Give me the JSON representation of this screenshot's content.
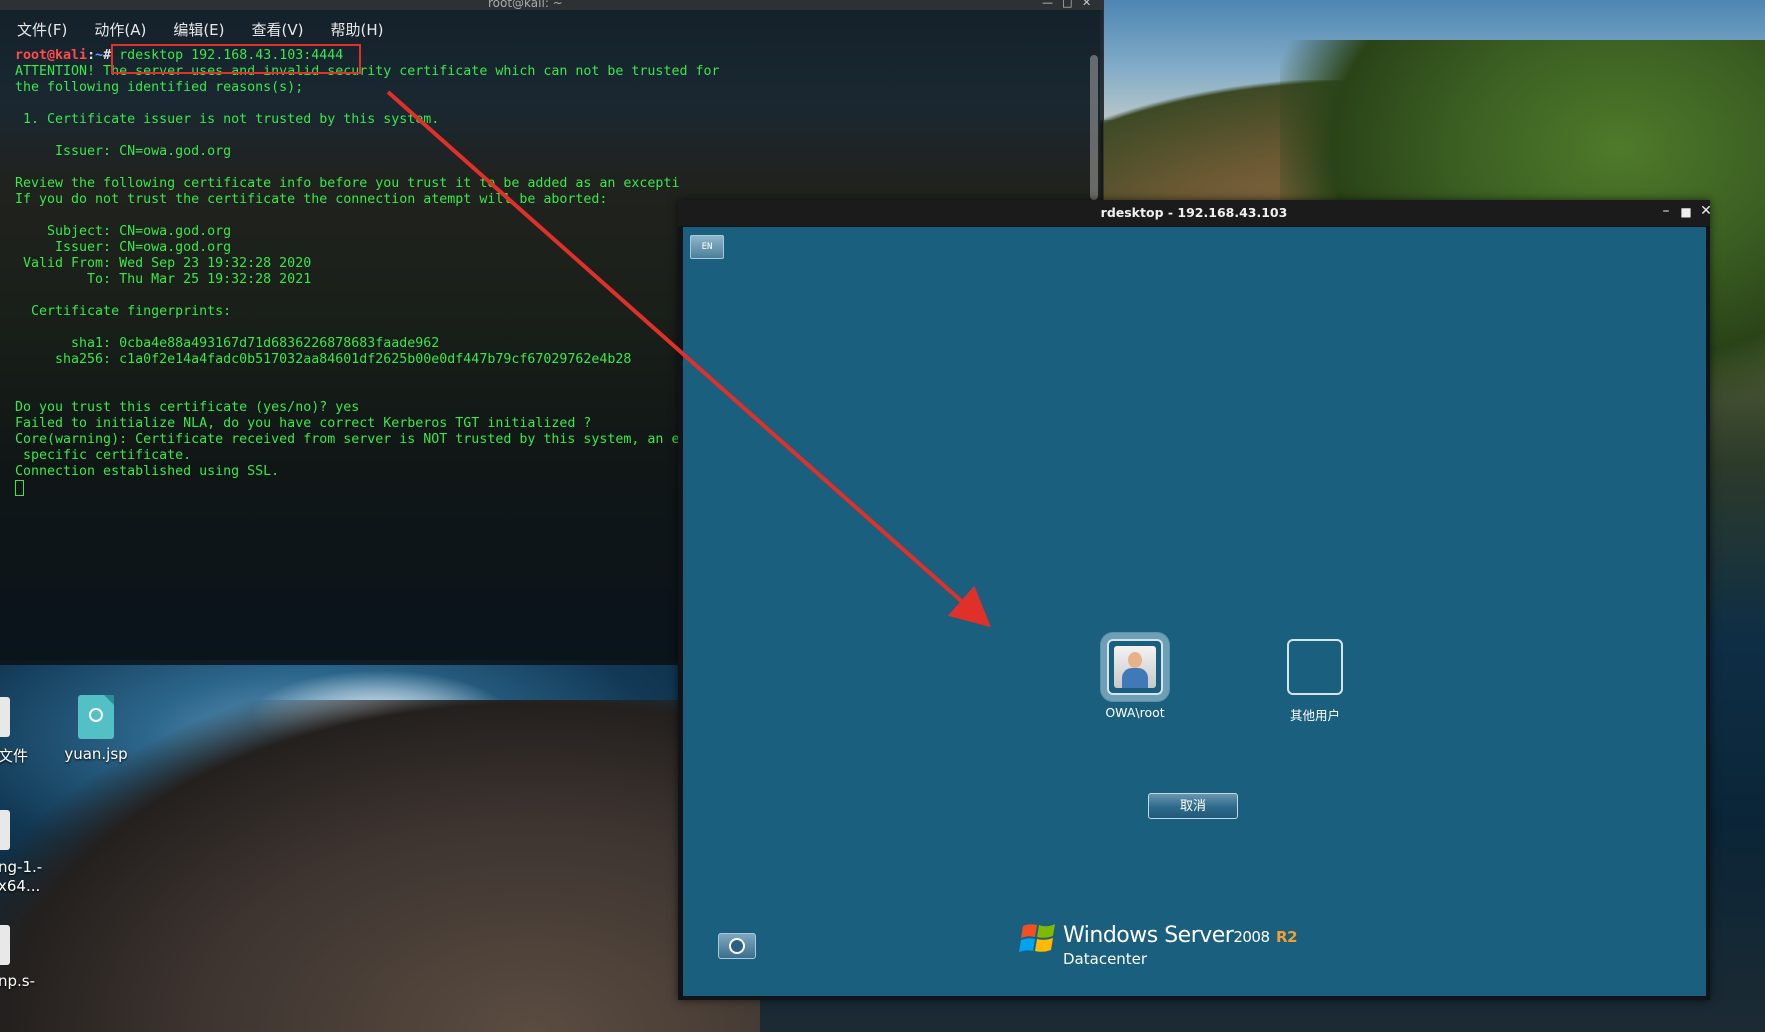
{
  "terminal": {
    "title": "root@kali: ~",
    "menu": [
      "文件(F)",
      "动作(A)",
      "编辑(E)",
      "查看(V)",
      "帮助(H)"
    ],
    "prompt": {
      "user": "root@kali",
      "sep": ":",
      "path": "~",
      "symbol": "#"
    },
    "command": "rdesktop 192.168.43.103:4444",
    "output_lines": [
      "ATTENTION! The server uses and invalid security certificate which can not be trusted for",
      "the following identified reasons(s);",
      "",
      " 1. Certificate issuer is not trusted by this system.",
      "",
      "     Issuer: CN=owa.god.org",
      "",
      "Review the following certificate info before you trust it to be added as an excepti",
      "If you do not trust the certificate the connection atempt will be aborted:",
      "",
      "    Subject: CN=owa.god.org",
      "     Issuer: CN=owa.god.org",
      " Valid From: Wed Sep 23 19:32:28 2020",
      "         To: Thu Mar 25 19:32:28 2021",
      "",
      "  Certificate fingerprints:",
      "",
      "       sha1: 0cba4e88a493167d71d6836226878683faade962",
      "     sha256: c1a0f2e14a4fadc0b517032aa84601df2625b00e0df447b79cf67029762e4b28",
      "",
      "",
      "Do you trust this certificate (yes/no)? yes",
      "Failed to initialize NLA, do you have correct Kerberos TGT initialized ?",
      "Core(warning): Certificate received from server is NOT trusted by this system, an e",
      " specific certificate.",
      "Connection established using SSL."
    ]
  },
  "desktop": {
    "icons": [
      {
        "label": "yuan.jsp",
        "icon": "web-file-icon"
      }
    ],
    "edge_labels": [
      "文件",
      "ng-1.-",
      "x64...",
      "np.s-"
    ]
  },
  "rdesktop": {
    "title": "rdesktop - 192.168.43.103",
    "lang_button": "EN",
    "users": [
      {
        "label": "OWA\\root",
        "icon": "user-avatar-icon",
        "selected": true
      },
      {
        "label": "其他用户",
        "icon": "blank-user-icon",
        "selected": false
      }
    ],
    "cancel_label": "取消",
    "brand": {
      "name": "Windows Server",
      "version": "2008",
      "release": "R2",
      "edition": "Datacenter"
    },
    "colors": {
      "background": "#1a5f7e",
      "titlebar": "#1b1b1b",
      "r2": "#f0a030"
    }
  },
  "annotation": {
    "color": "#e0302a"
  }
}
